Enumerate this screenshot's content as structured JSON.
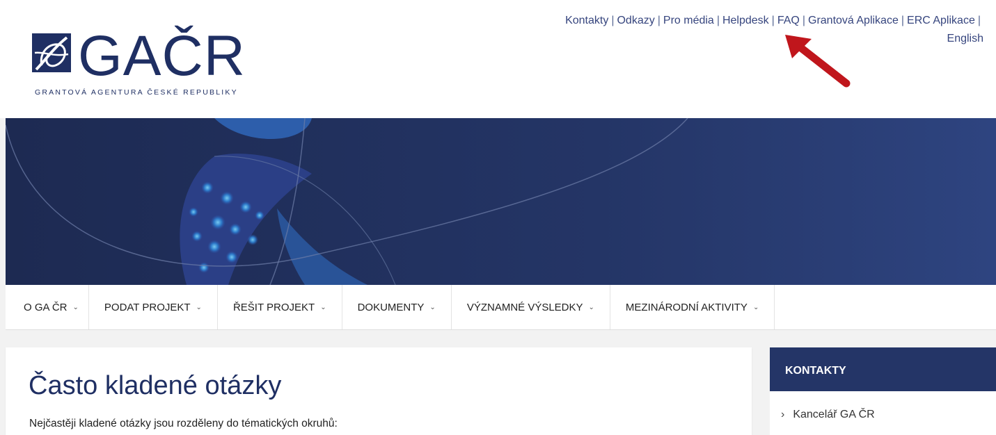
{
  "header": {
    "logo_text": "GAČR",
    "logo_subtitle": "GRANTOVÁ AGENTURA ČESKÉ REPUBLIKY",
    "top_links": [
      "Kontakty",
      "Odkazy",
      "Pro média",
      "Helpdesk",
      "FAQ",
      "Grantová Aplikace",
      "ERC Aplikace",
      "English"
    ],
    "separator": "|"
  },
  "nav": {
    "items": [
      "O GA ČR",
      "PODAT PROJEKT",
      "ŘEŠIT PROJEKT",
      "DOKUMENTY",
      "VÝZNAMNÉ VÝSLEDKY",
      "MEZINÁRODNÍ AKTIVITY"
    ],
    "chevron": "⌄"
  },
  "main": {
    "title": "Často kladené otázky",
    "intro": "Nejčastěji kladené otázky jsou rozděleny do tématických okruhů:"
  },
  "sidebar": {
    "heading": "KONTAKTY",
    "items": [
      "Kancelář GA ČR"
    ],
    "arrow": "›"
  },
  "colors": {
    "brand_navy": "#1f2f63",
    "link": "#36457e",
    "sidebar_head": "#243567",
    "annotation_arrow": "#c0161c"
  }
}
